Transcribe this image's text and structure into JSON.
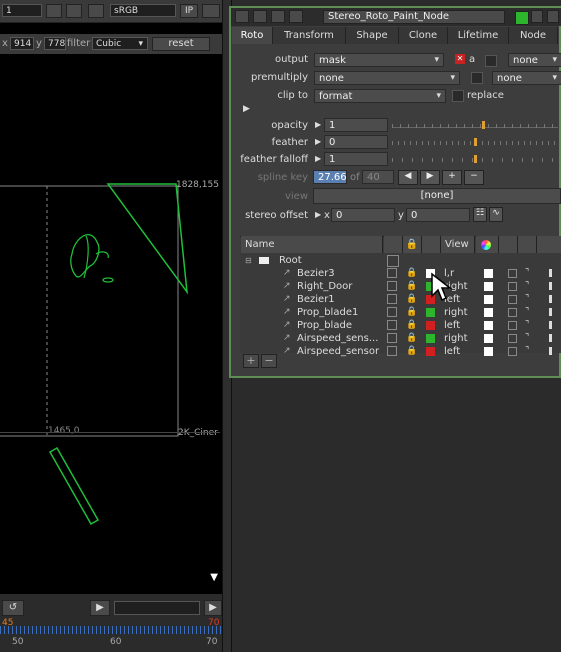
{
  "viewer": {
    "top_value1": "1",
    "colorspace": "sRGB",
    "ip_label": "IP",
    "x_label": "x",
    "x_value": "914",
    "y_label": "y",
    "y_value": "778",
    "filter_label": "filter",
    "filter_value": "Cubic",
    "reset_label": "reset",
    "coord_top_right": "1828,155",
    "coord_bottom": "1465,0",
    "format_label": "2K_Ciner",
    "timeline": {
      "start": "50",
      "mid": "60",
      "end": "70",
      "marker_left": "45",
      "marker_right": "70"
    }
  },
  "panel": {
    "node_name": "Stereo_Roto_Paint_Node",
    "tabs": [
      "Roto",
      "Transform",
      "Shape",
      "Clone",
      "Lifetime",
      "Node"
    ],
    "active_tab": "Roto",
    "output": {
      "label": "output",
      "value": "mask",
      "a_label": "a",
      "right_value": "none"
    },
    "premultiply": {
      "label": "premultiply",
      "value": "none",
      "right_value": "none"
    },
    "clip_to": {
      "label": "clip to",
      "value": "format",
      "replace_label": "replace"
    },
    "opacity": {
      "label": "opacity",
      "value": "1"
    },
    "feather": {
      "label": "feather",
      "value": "0"
    },
    "feather_falloff": {
      "label": "feather falloff",
      "value": "1"
    },
    "spline_key": {
      "label": "spline key",
      "value": "27.66",
      "of_label": "of",
      "total": "40"
    },
    "view": {
      "label": "view",
      "value": "[none]"
    },
    "stereo_offset": {
      "label": "stereo offset",
      "x_label": "x",
      "x_value": "0",
      "y_label": "y",
      "y_value": "0"
    },
    "slider_ticks_opacity": [
      "0",
      "0.1",
      "0.2",
      "0.3",
      "0.4",
      "0.5",
      "0.6",
      "0.7",
      "0.8",
      "0.9",
      "1"
    ],
    "slider_ticks_feather": [
      "-100",
      "-75",
      "-50",
      "-25",
      "0",
      "25",
      "50",
      "75",
      "100"
    ],
    "slider_ticks_falloff": [
      "0",
      "1",
      "2",
      "3",
      "4"
    ]
  },
  "tree": {
    "headers": {
      "name": "Name",
      "view": "View"
    },
    "root": "Root",
    "rows": [
      {
        "name": "Bezier3",
        "view": "l,r",
        "color": "#ffffff"
      },
      {
        "name": "Right_Door",
        "view": "right",
        "color": "#2db52d"
      },
      {
        "name": "Bezier1",
        "view": "left",
        "color": "#d21f1f"
      },
      {
        "name": "Prop_blade1",
        "view": "right",
        "color": "#2db52d"
      },
      {
        "name": "Prop_blade",
        "view": "left",
        "color": "#d21f1f"
      },
      {
        "name": "Airspeed_sens...",
        "view": "right",
        "color": "#2db52d"
      },
      {
        "name": "Airspeed_sensor",
        "view": "left",
        "color": "#d21f1f"
      }
    ],
    "add_label": "+",
    "remove_label": "−"
  }
}
